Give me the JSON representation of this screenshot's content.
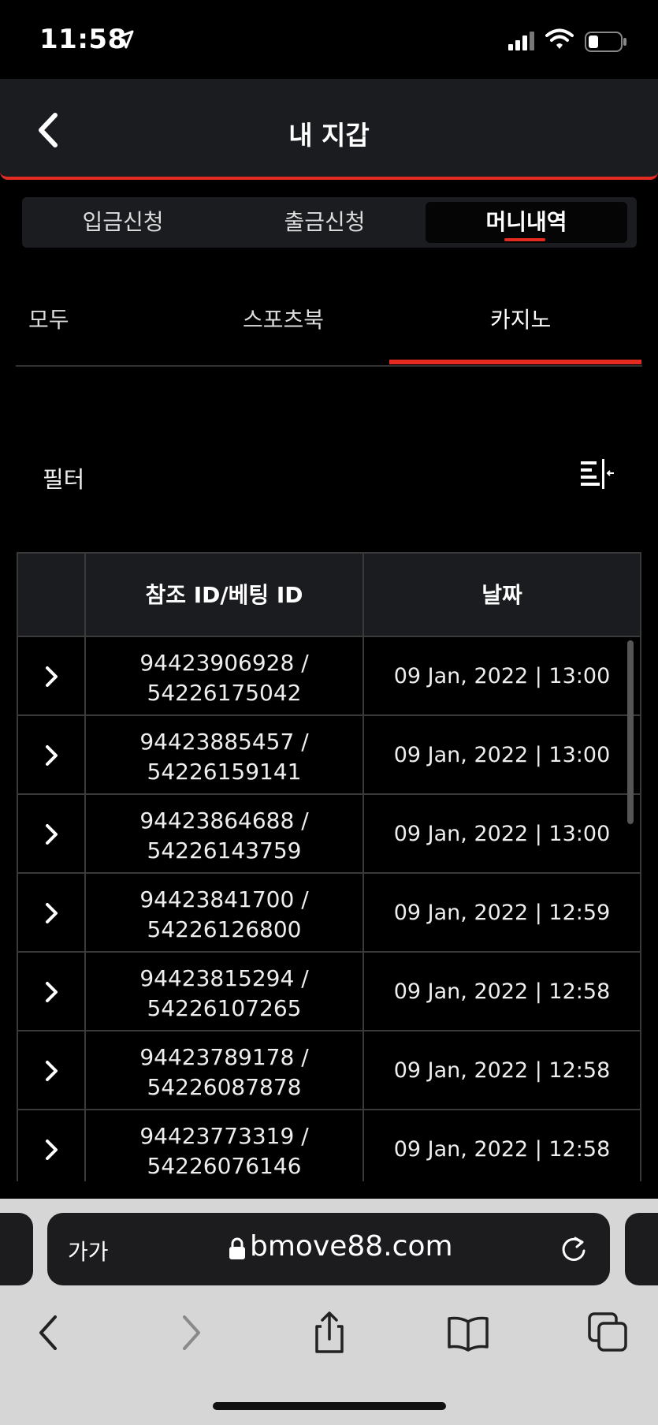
{
  "status_bar": {
    "time": "11:58"
  },
  "header": {
    "title": "내 지갑"
  },
  "main_tabs": [
    {
      "label": "입금신청"
    },
    {
      "label": "출금신청"
    },
    {
      "label": "머니내역"
    }
  ],
  "sub_tabs": [
    {
      "label": "모두"
    },
    {
      "label": "스포츠북"
    },
    {
      "label": "카지노"
    }
  ],
  "filter": {
    "label": "필터"
  },
  "table": {
    "headers": [
      "",
      "참조 ID/베팅 ID",
      "날짜"
    ],
    "rows": [
      {
        "ref_id": "94423906928 /",
        "bet_id": "54226175042",
        "date": "09 Jan, 2022 | 13:00"
      },
      {
        "ref_id": "94423885457 /",
        "bet_id": "54226159141",
        "date": "09 Jan, 2022 | 13:00"
      },
      {
        "ref_id": "94423864688 /",
        "bet_id": "54226143759",
        "date": "09 Jan, 2022 | 13:00"
      },
      {
        "ref_id": "94423841700 /",
        "bet_id": "54226126800",
        "date": "09 Jan, 2022 | 12:59"
      },
      {
        "ref_id": "94423815294 /",
        "bet_id": "54226107265",
        "date": "09 Jan, 2022 | 12:58"
      },
      {
        "ref_id": "94423789178 /",
        "bet_id": "54226087878",
        "date": "09 Jan, 2022 | 12:58"
      },
      {
        "ref_id": "94423773319 /",
        "bet_id": "54226076146",
        "date": "09 Jan, 2022 | 12:58"
      }
    ]
  },
  "browser": {
    "text_size_label": "가가",
    "url": "bmove88.com"
  },
  "colors": {
    "accent": "#e32b21",
    "header_bg": "#1b1c20",
    "background": "#000000"
  },
  "icons": [
    "location-arrow-icon",
    "signal-icon",
    "wifi-icon",
    "battery-icon",
    "back-chevron-icon",
    "filter-icon",
    "chevron-right-icon",
    "lock-icon",
    "reload-icon",
    "back-icon",
    "forward-icon",
    "share-icon",
    "bookmarks-icon",
    "tabs-icon"
  ]
}
